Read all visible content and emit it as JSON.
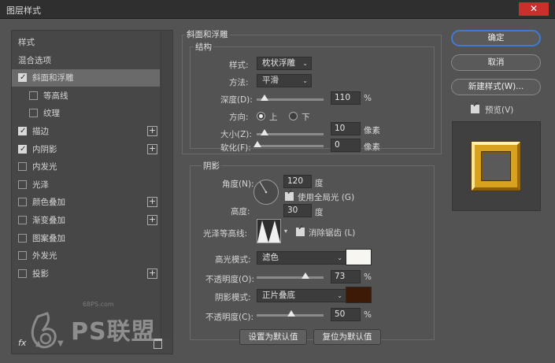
{
  "window": {
    "title": "图层样式",
    "close_glyph": "✕"
  },
  "left_panel": {
    "items": [
      {
        "label": "样式",
        "checkbox": null,
        "plus": false,
        "selected": false,
        "indent": false
      },
      {
        "label": "混合选项",
        "checkbox": null,
        "plus": false,
        "selected": false,
        "indent": false
      },
      {
        "label": "斜面和浮雕",
        "checkbox": true,
        "plus": false,
        "selected": true,
        "indent": false
      },
      {
        "label": "等高线",
        "checkbox": false,
        "plus": false,
        "selected": false,
        "indent": true
      },
      {
        "label": "纹理",
        "checkbox": false,
        "plus": false,
        "selected": false,
        "indent": true
      },
      {
        "label": "描边",
        "checkbox": true,
        "plus": true,
        "selected": false,
        "indent": false
      },
      {
        "label": "内阴影",
        "checkbox": true,
        "plus": true,
        "selected": false,
        "indent": false
      },
      {
        "label": "内发光",
        "checkbox": false,
        "plus": false,
        "selected": false,
        "indent": false
      },
      {
        "label": "光泽",
        "checkbox": false,
        "plus": false,
        "selected": false,
        "indent": false
      },
      {
        "label": "颜色叠加",
        "checkbox": false,
        "plus": true,
        "selected": false,
        "indent": false
      },
      {
        "label": "渐变叠加",
        "checkbox": false,
        "plus": true,
        "selected": false,
        "indent": false
      },
      {
        "label": "图案叠加",
        "checkbox": false,
        "plus": false,
        "selected": false,
        "indent": false
      },
      {
        "label": "外发光",
        "checkbox": false,
        "plus": false,
        "selected": false,
        "indent": false
      },
      {
        "label": "投影",
        "checkbox": false,
        "plus": true,
        "selected": false,
        "indent": false
      }
    ],
    "fx_label": "fx",
    "plus_glyph": "+"
  },
  "watermark": {
    "url": "68PS.com",
    "text": "PS联盟"
  },
  "bevel": {
    "group_title": "斜面和浮雕",
    "structure_title": "结构",
    "style_label": "样式:",
    "style_value": "枕状浮雕",
    "technique_label": "方法:",
    "technique_value": "平滑",
    "depth_label": "深度(D):",
    "depth_value": "110",
    "depth_unit": "%",
    "direction_label": "方向:",
    "direction_up": "上",
    "direction_down": "下",
    "size_label": "大小(Z):",
    "size_value": "10",
    "size_unit": "像素",
    "soften_label": "软化(F):",
    "soften_value": "0",
    "soften_unit": "像素"
  },
  "shading": {
    "title": "阴影",
    "angle_label": "角度(N):",
    "angle_value": "120",
    "angle_unit": "度",
    "global_light_label": "使用全局光 (G)",
    "altitude_label": "高度:",
    "altitude_value": "30",
    "altitude_unit": "度",
    "gloss_contour_label": "光泽等高线:",
    "antialias_label": "消除锯齿 (L)",
    "highlight_mode_label": "高光模式:",
    "highlight_mode_value": "滤色",
    "highlight_color": "#f8f6f0",
    "highlight_opacity_label": "不透明度(O):",
    "highlight_opacity_value": "73",
    "shadow_mode_label": "阴影模式:",
    "shadow_mode_value": "正片叠底",
    "shadow_color": "#3d1a05",
    "shadow_opacity_label": "不透明度(C):",
    "shadow_opacity_value": "50",
    "percent": "%"
  },
  "bottom_buttons": {
    "set_default": "设置为默认值",
    "reset_default": "复位为默认值"
  },
  "right": {
    "ok": "确定",
    "cancel": "取消",
    "new_style": "新建样式(W)...",
    "preview_label": "预览(V)"
  },
  "colors": {
    "accent": "#3f7ad6",
    "gold": "#d8a21e"
  }
}
